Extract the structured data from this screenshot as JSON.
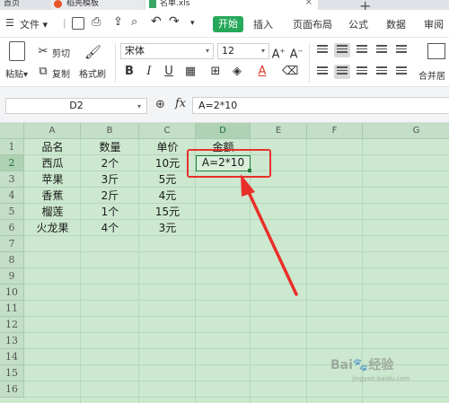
{
  "tabs": {
    "home": "首页",
    "templates": "稻壳模板",
    "file": "名单.xls",
    "close_symbol": "×",
    "add_symbol": "+"
  },
  "menu": {
    "file_label": "文件",
    "start": "开始",
    "insert": "插入",
    "page_layout": "页面布局",
    "formula": "公式",
    "data": "数据",
    "review": "审阅"
  },
  "ribbon": {
    "paste": "粘贴",
    "cut": "剪切",
    "copy": "复制",
    "format_painter": "格式刷",
    "font_name": "宋体",
    "font_size": "12",
    "bold": "B",
    "italic": "I",
    "underline": "U",
    "merge_center": "合并居"
  },
  "formula_bar": {
    "name_box": "D2",
    "fx": "fx",
    "formula": "A=2*10"
  },
  "grid": {
    "columns": [
      "A",
      "B",
      "C",
      "D",
      "E",
      "F",
      "G"
    ],
    "row_numbers": [
      "1",
      "2",
      "3",
      "4",
      "5",
      "6",
      "7",
      "8",
      "9",
      "10",
      "11",
      "12",
      "13",
      "14",
      "15",
      "16"
    ],
    "header_row": [
      "品名",
      "数量",
      "单价",
      "金额"
    ],
    "rows": [
      [
        "西瓜",
        "2个",
        "10元",
        "A=2*10"
      ],
      [
        "苹果",
        "3斤",
        "5元",
        ""
      ],
      [
        "香蕉",
        "2斤",
        "4元",
        ""
      ],
      [
        "榴莲",
        "1个",
        "15元",
        ""
      ],
      [
        "火龙果",
        "4个",
        "3元",
        ""
      ]
    ],
    "selected_cell": "D2"
  },
  "watermark": {
    "main": "Bai🐾经验",
    "sub": "jingyan.baidu.com"
  },
  "colors": {
    "accent_green": "#25a85a",
    "grid_background": "#cce8cf",
    "annotation_red": "#e8302a"
  }
}
